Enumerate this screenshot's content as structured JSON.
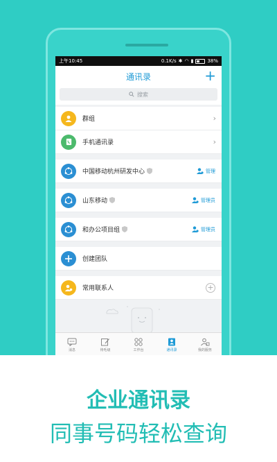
{
  "status": {
    "time": "上午10:45",
    "signal": "0.1K/s",
    "battery": "38%",
    "battery_fraction": 0.38
  },
  "header": {
    "title": "通讯录",
    "add": "+"
  },
  "search": {
    "placeholder": "搜索"
  },
  "items": {
    "groups": "群组",
    "phone_contacts": "手机通讯录",
    "org1": "中国移动杭州研发中心",
    "org1_action": "管理",
    "org2": "山东移动",
    "org2_action": "管理员",
    "org3": "和办公项目组",
    "org3_action": "管理员",
    "create_team": "创建团队",
    "frequent": "常用联系人"
  },
  "tabs": [
    "消息",
    "待毛级",
    "工作台",
    "通讯录",
    "我的服务"
  ],
  "caption": {
    "title": "企业通讯录",
    "subtitle": "同事号码轻松查询"
  },
  "colors": {
    "teal": "#2fcdc4",
    "blue": "#1e9ad6",
    "yellow": "#f5b71d",
    "green": "#4cba6c"
  }
}
